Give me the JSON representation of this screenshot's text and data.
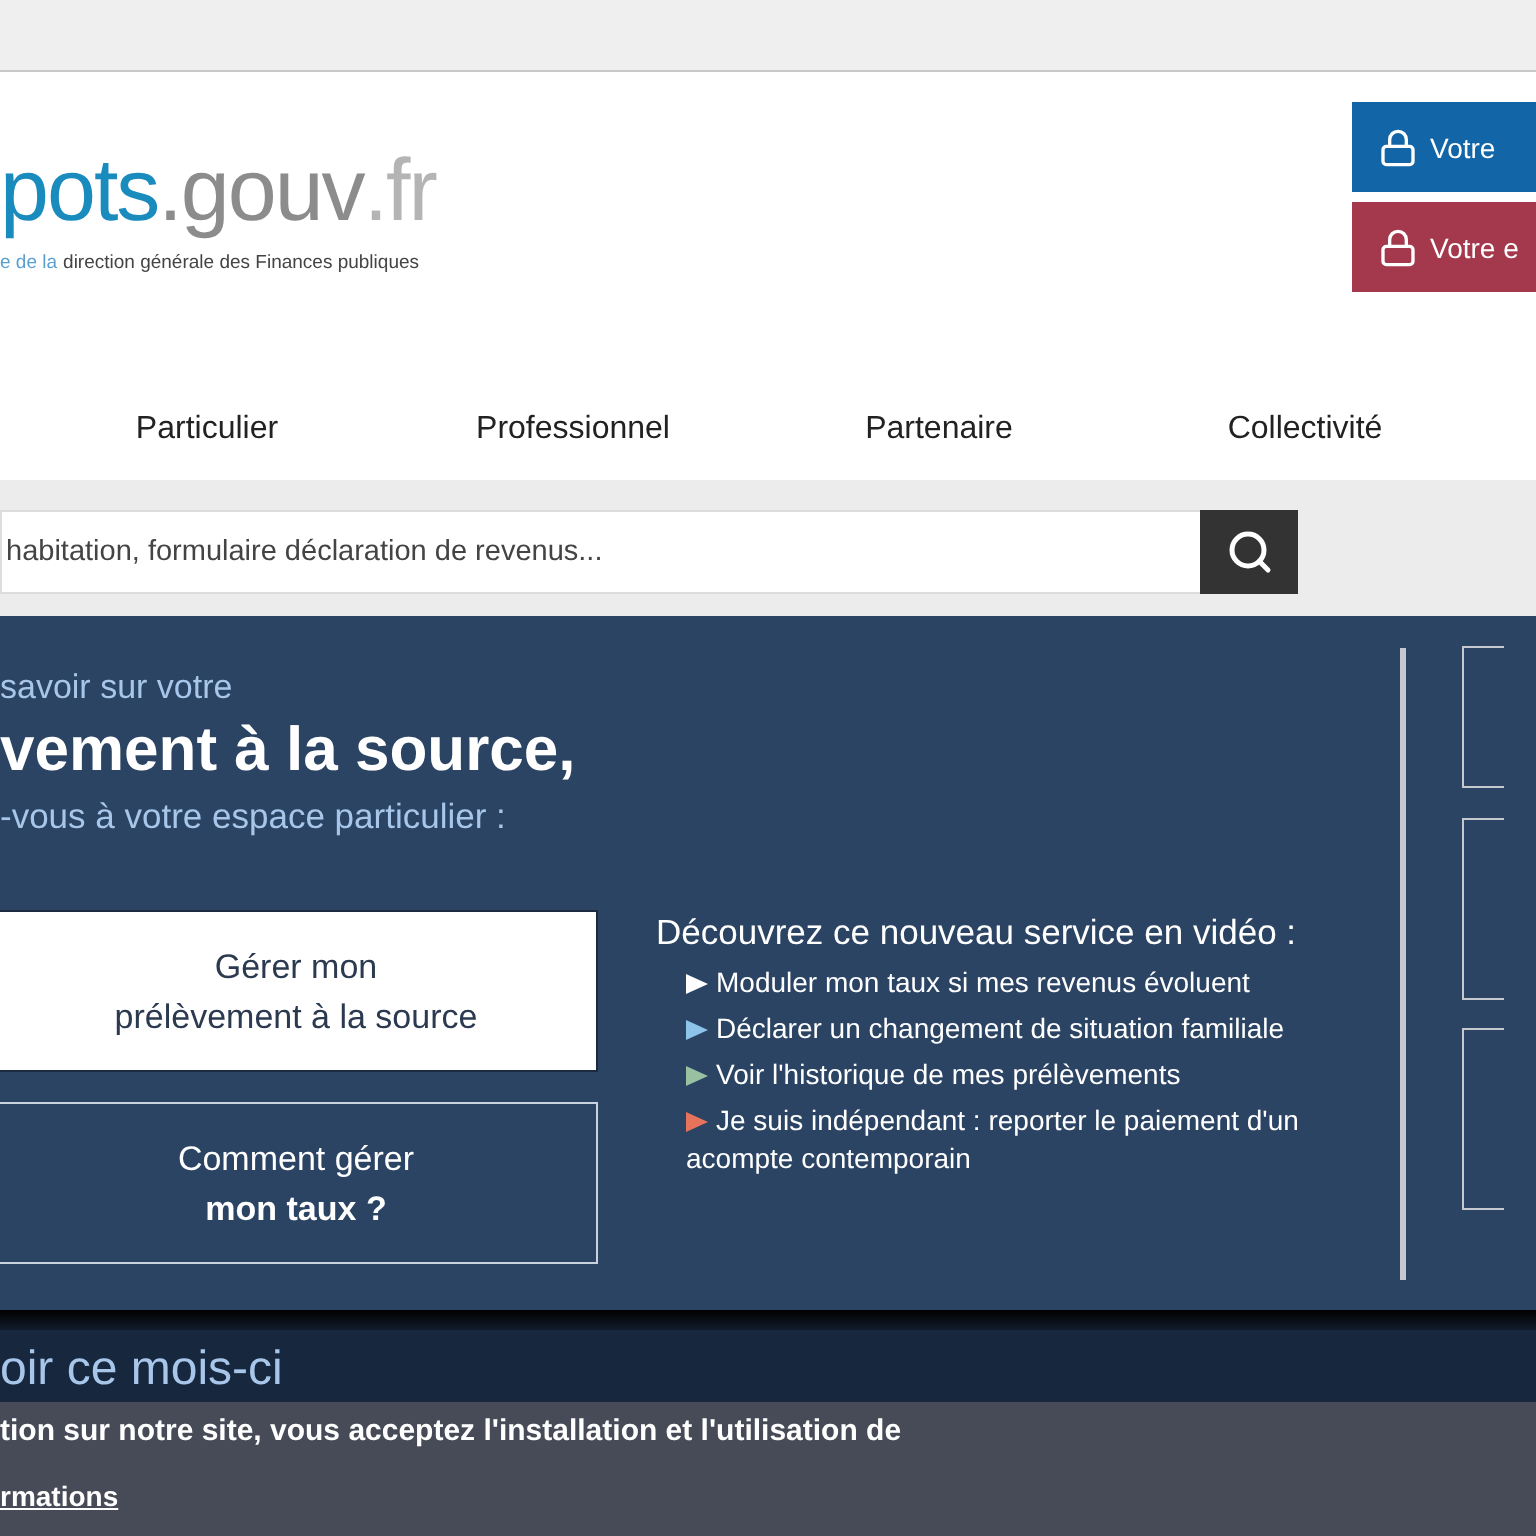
{
  "logo": {
    "name_part": "pots",
    "domain_part": ".gouv",
    "tld_part": ".fr",
    "tagline_lead": "e de la",
    "tagline": "direction générale des Finances publiques"
  },
  "account_buttons": [
    {
      "label": "Votre",
      "kind": "primary"
    },
    {
      "label": "Votre e",
      "kind": "secondary"
    }
  ],
  "nav": [
    {
      "label": "Particulier"
    },
    {
      "label": "Professionnel"
    },
    {
      "label": "Partenaire"
    },
    {
      "label": "Collectivité"
    }
  ],
  "search": {
    "placeholder": "habitation, formulaire déclaration de revenus..."
  },
  "hero": {
    "kicker": "savoir sur votre",
    "title": "vement à la source,",
    "subtitle": "-vous à votre espace particulier :",
    "buttons": [
      {
        "line1": "Gérer mon",
        "line2": "prélèvement à la source",
        "kind": "filled"
      },
      {
        "line1": "Comment gérer",
        "line2": "mon taux ?",
        "kind": "outline"
      }
    ],
    "video_heading": "Découvrez ce nouveau service en vidéo :",
    "video_links": [
      {
        "label": "Moduler mon taux si mes revenus évoluent",
        "color": "#ffffff"
      },
      {
        "label": "Déclarer un changement de situation familiale",
        "color": "#8ec3ea"
      },
      {
        "label": "Voir l'historique de mes prélèvements",
        "color": "#97c1a0"
      },
      {
        "label": "Je suis indépendant : reporter le paiement d'un acompte contemporain",
        "color": "#e8735c"
      }
    ]
  },
  "next_section": {
    "title": "oir ce mois-ci"
  },
  "cookie_banner": {
    "text": "tion sur notre site, vous acceptez l'installation et l'utilisation de",
    "link": "rmations"
  }
}
